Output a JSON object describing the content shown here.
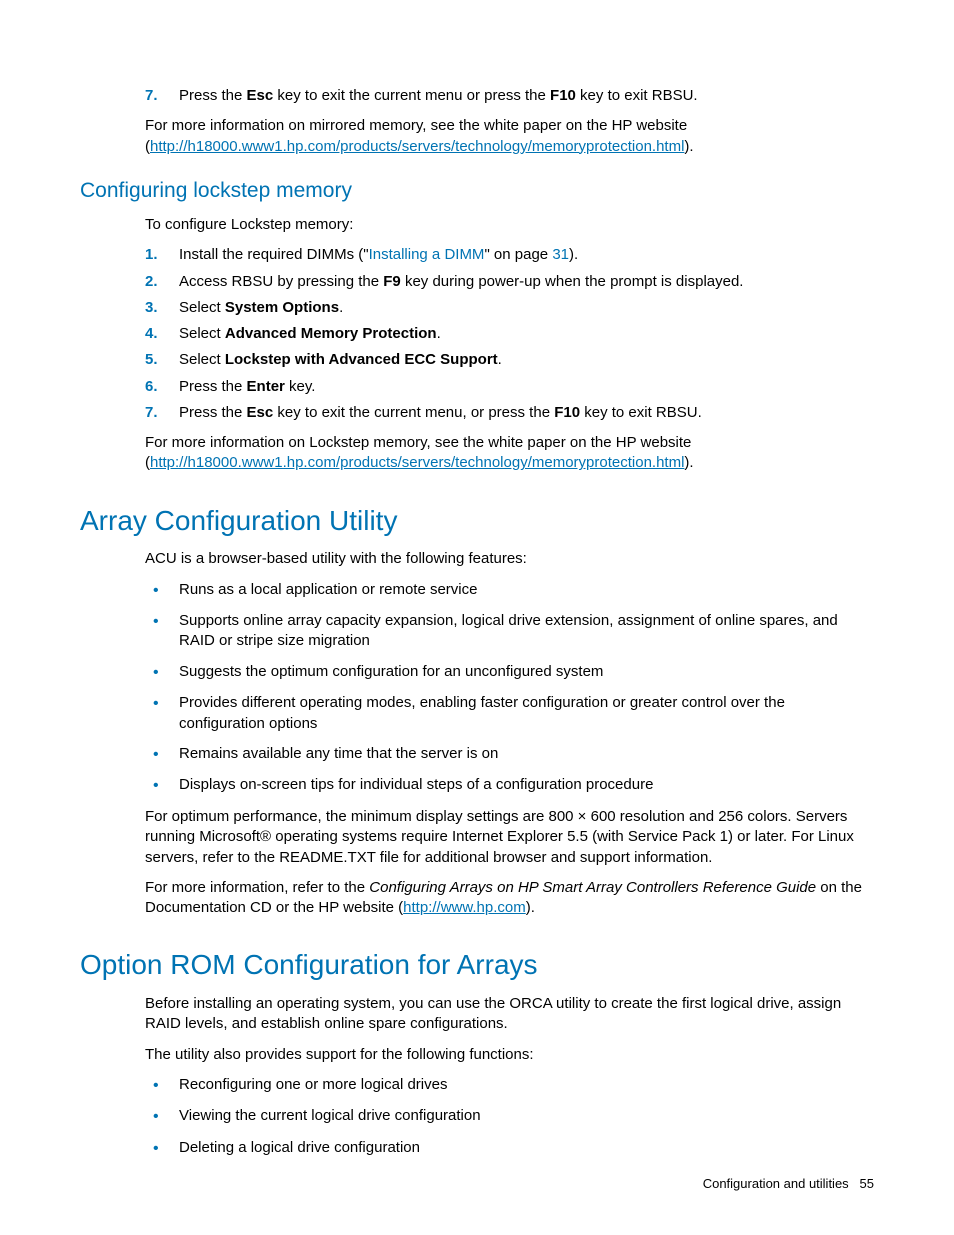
{
  "top_list": {
    "item7_pre": "Press the ",
    "item7_esc": "Esc",
    "item7_mid": " key to exit the current menu or press the ",
    "item7_f10": "F10",
    "item7_post": " key to exit RBSU."
  },
  "top_para": {
    "pre": "For more information on mirrored memory, see the white paper on the HP website (",
    "url": "http://h18000.www1.hp.com/products/servers/technology/memoryprotection.html",
    "post": ")."
  },
  "lockstep": {
    "heading": "Configuring lockstep memory",
    "intro": "To configure Lockstep memory:",
    "steps": {
      "s1_pre": "Install the required DIMMs (\"",
      "s1_link": "Installing a DIMM",
      "s1_mid": "\" on page ",
      "s1_page": "31",
      "s1_post": ").",
      "s2_pre": "Access RBSU by pressing the ",
      "s2_f9": "F9",
      "s2_post": " key during power-up when the prompt is displayed.",
      "s3_pre": "Select ",
      "s3_b": "System Options",
      "s3_post": ".",
      "s4_pre": "Select ",
      "s4_b": "Advanced Memory Protection",
      "s4_post": ".",
      "s5_pre": "Select ",
      "s5_b": "Lockstep with Advanced ECC Support",
      "s5_post": ".",
      "s6_pre": "Press the ",
      "s6_b": "Enter",
      "s6_post": " key.",
      "s7_pre": "Press the ",
      "s7_esc": "Esc",
      "s7_mid": " key to exit the current menu, or press the ",
      "s7_f10": "F10",
      "s7_post": " key to exit RBSU."
    },
    "outro_pre": "For more information on Lockstep memory, see the white paper on the HP website (",
    "outro_url": "http://h18000.www1.hp.com/products/servers/technology/memoryprotection.html",
    "outro_post": ")."
  },
  "acu": {
    "heading": "Array Configuration Utility",
    "intro": "ACU is a browser-based utility with the following features:",
    "bullets": [
      "Runs as a local application or remote service",
      "Supports online array capacity expansion, logical drive extension, assignment of online spares, and RAID or stripe size migration",
      "Suggests the optimum configuration for an unconfigured system",
      "Provides different operating modes, enabling faster configuration or greater control over the configuration options",
      "Remains available any time that the server is on",
      "Displays on-screen tips for individual steps of a configuration procedure"
    ],
    "para1": "For optimum performance, the minimum display settings are 800 × 600 resolution and 256 colors. Servers running Microsoft® operating systems require Internet Explorer 5.5 (with Service Pack 1) or later. For Linux servers, refer to the README.TXT file for additional browser and support information.",
    "para2_pre": "For more information, refer to the ",
    "para2_i": "Configuring Arrays on HP Smart Array Controllers Reference Guide",
    "para2_mid": " on the Documentation CD or the HP website (",
    "para2_url": "http://www.hp.com",
    "para2_post": ")."
  },
  "orca": {
    "heading": "Option ROM Configuration for Arrays",
    "para1": "Before installing an operating system, you can use the ORCA utility to create the first logical drive, assign RAID levels, and establish online spare configurations.",
    "para2": "The utility also provides support for the following functions:",
    "bullets": [
      "Reconfiguring one or more logical drives",
      "Viewing the current logical drive configuration",
      "Deleting a logical drive configuration"
    ]
  },
  "footer": {
    "section": "Configuration and utilities",
    "page": "55"
  }
}
